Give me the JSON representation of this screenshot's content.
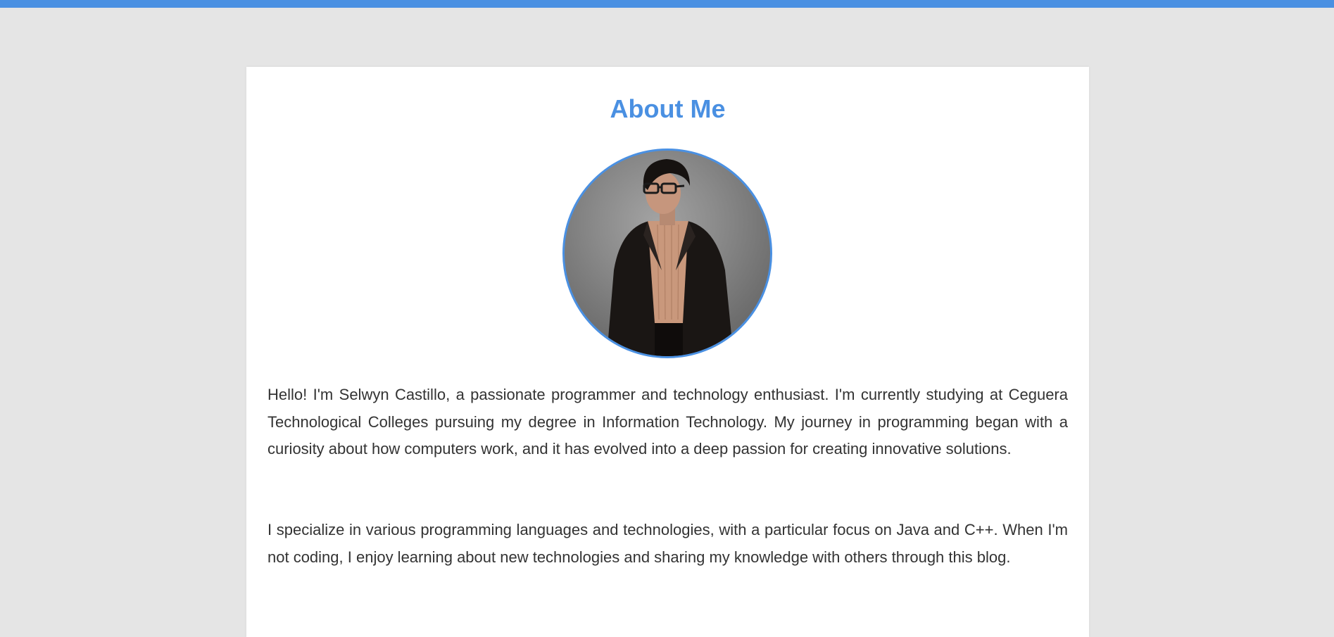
{
  "page": {
    "accent_color": "#4a90e2",
    "background_color": "#e5e5e5",
    "card_color": "#ffffff",
    "text_color": "#333333"
  },
  "about": {
    "title": "About Me",
    "profile_image": "profile-photo",
    "paragraphs": [
      "Hello! I'm Selwyn Castillo, a passionate programmer and technology enthusiast. I'm currently studying at Ceguera Technological Colleges pursuing my degree in Information Technology. My journey in programming began with a curiosity about how computers work, and it has evolved into a deep passion for creating innovative solutions.",
      "I specialize in various programming languages and technologies, with a particular focus on Java and C++. When I'm not coding, I enjoy learning about new technologies and sharing my knowledge with others through this blog."
    ]
  }
}
